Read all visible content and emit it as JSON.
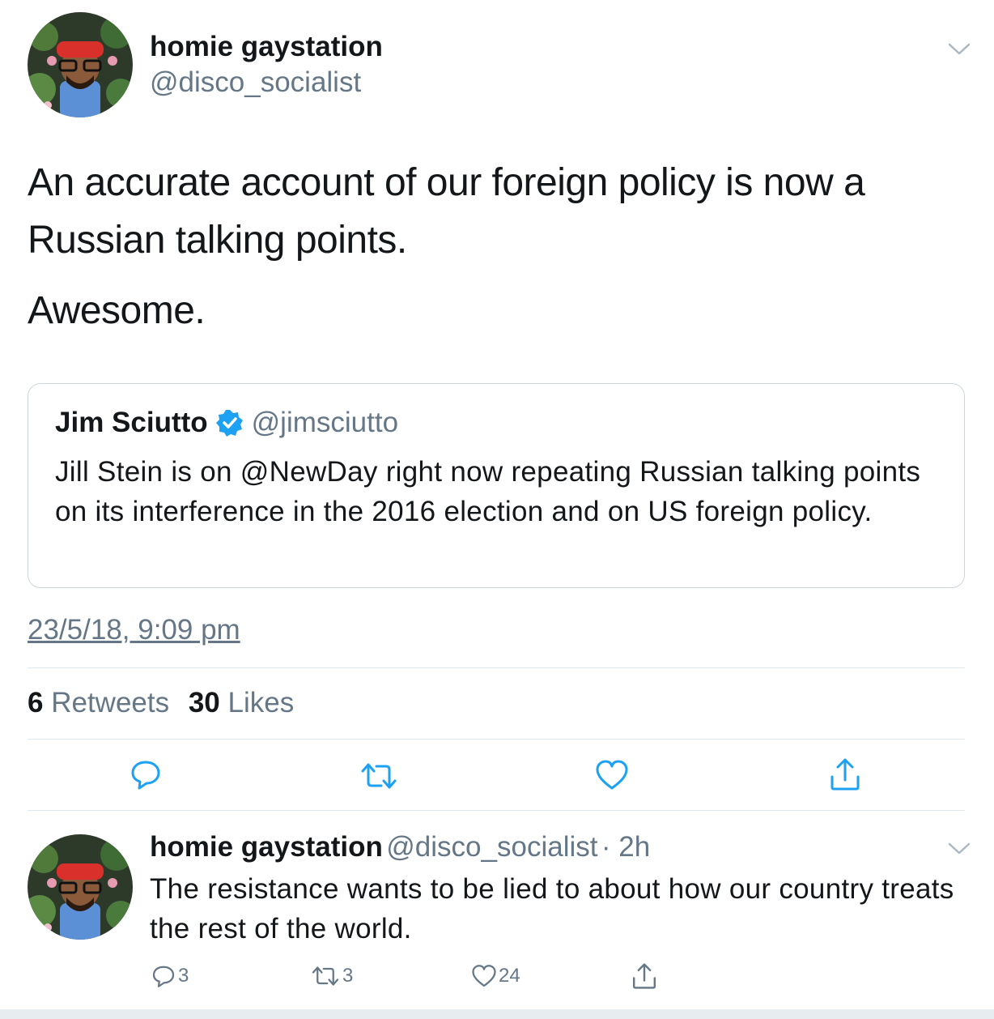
{
  "main_tweet": {
    "author_name": "homie gaystation",
    "author_handle": "@disco_socialist",
    "text_line1": "An accurate account of our foreign policy is now a",
    "text_line2": "Russian talking points.",
    "text_line3": "Awesome.",
    "avatar_icon": "avatar-icon",
    "menu_icon": "chevron-down-icon"
  },
  "quoted_tweet": {
    "author_name": "Jim Sciutto",
    "author_handle": "@jimsciutto",
    "verified_icon": "verified-badge-icon",
    "text": "Jill Stein is on @NewDay right now repeating Russian talking points on its interference in the 2016 election and on US foreign policy."
  },
  "timestamp": "23/5/18, 9:09 pm",
  "stats": {
    "retweets_count": "6",
    "retweets_label": "Retweets",
    "likes_count": "30",
    "likes_label": "Likes"
  },
  "actions": {
    "reply_icon": "reply-icon",
    "retweet_icon": "retweet-icon",
    "like_icon": "heart-icon",
    "share_icon": "share-icon"
  },
  "reply_tweet": {
    "author_name": "homie gaystation",
    "author_handle": "@disco_socialist",
    "time": "· 2h",
    "text": "The resistance wants to be lied to about how our country treats the rest of the world.",
    "reply_count": "3",
    "retweet_count": "3",
    "like_count": "24"
  },
  "colors": {
    "text_primary": "#14171a",
    "text_secondary": "#657786",
    "icon": "#1da1f2",
    "border": "#e1e8ed"
  }
}
